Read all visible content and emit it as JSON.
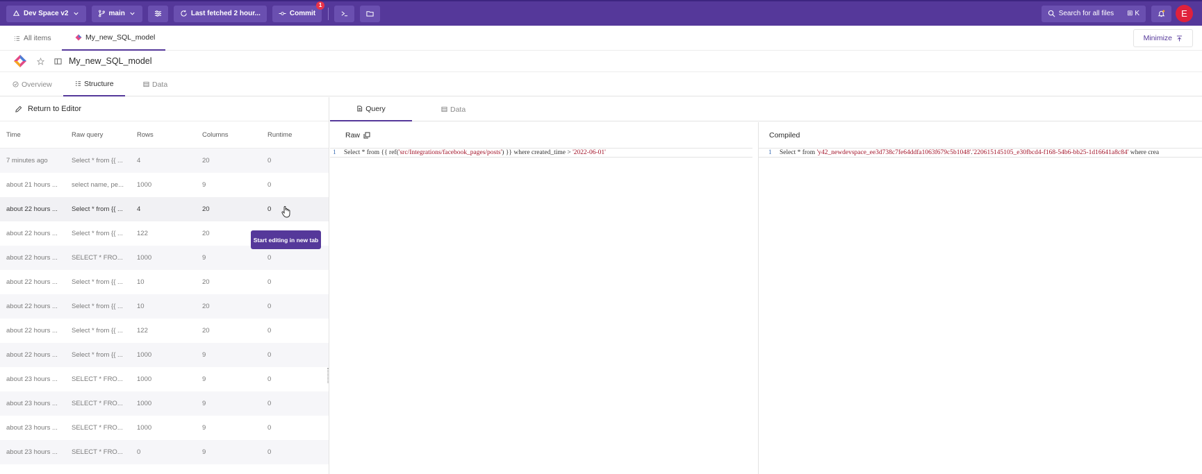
{
  "topbar": {
    "space": "Dev Space v2",
    "branch": "main",
    "fetched": "Last fetched 2 hour...",
    "commit": "Commit",
    "commit_badge": "1",
    "search": "Search for all files",
    "shortcut": "⊞ K",
    "avatar": "E"
  },
  "tabs": {
    "all_items": "All items",
    "model_tab": "My_new_SQL_model",
    "minimize": "Minimize"
  },
  "title": "My_new_SQL_model",
  "subtabs": {
    "overview": "Overview",
    "structure": "Structure",
    "data": "Data"
  },
  "left": {
    "return": "Return to Editor",
    "columns": [
      "Time",
      "Raw query",
      "Rows",
      "Columns",
      "Runtime"
    ],
    "rows": [
      {
        "time": "7 minutes ago",
        "query": "Select * from {{ ...",
        "rows": "4",
        "columns": "20",
        "runtime": "0"
      },
      {
        "time": "about 21 hours ...",
        "query": "select name, pe...",
        "rows": "1000",
        "columns": "9",
        "runtime": "0"
      },
      {
        "time": "about 22 hours ...",
        "query": "Select * from {{ ...",
        "rows": "4",
        "columns": "20",
        "runtime": "0"
      },
      {
        "time": "about 22 hours ...",
        "query": "Select * from {{ ...",
        "rows": "122",
        "columns": "20",
        "runtime": ""
      },
      {
        "time": "about 22 hours ...",
        "query": "SELECT * FRO...",
        "rows": "1000",
        "columns": "9",
        "runtime": "0"
      },
      {
        "time": "about 22 hours ...",
        "query": "Select * from {{ ...",
        "rows": "10",
        "columns": "20",
        "runtime": "0"
      },
      {
        "time": "about 22 hours ...",
        "query": "Select * from {{ ...",
        "rows": "10",
        "columns": "20",
        "runtime": "0"
      },
      {
        "time": "about 22 hours ...",
        "query": "Select * from {{ ...",
        "rows": "122",
        "columns": "20",
        "runtime": "0"
      },
      {
        "time": "about 22 hours ...",
        "query": "Select * from {{ ...",
        "rows": "1000",
        "columns": "9",
        "runtime": "0"
      },
      {
        "time": "about 23 hours ...",
        "query": "SELECT * FRO...",
        "rows": "1000",
        "columns": "9",
        "runtime": "0"
      },
      {
        "time": "about 23 hours ...",
        "query": "SELECT * FRO...",
        "rows": "1000",
        "columns": "9",
        "runtime": "0"
      },
      {
        "time": "about 23 hours ...",
        "query": "SELECT * FRO...",
        "rows": "1000",
        "columns": "9",
        "runtime": "0"
      },
      {
        "time": "about 23 hours ...",
        "query": "SELECT * FRO...",
        "rows": "0",
        "columns": "9",
        "runtime": "0"
      }
    ],
    "tooltip": "Start editing in new tab"
  },
  "right": {
    "tab_query": "Query",
    "tab_data": "Data",
    "raw_label": "Raw",
    "compiled_label": "Compiled",
    "raw_line_no": "1",
    "raw_p1": "Select * from {{ ref(",
    "raw_s1": "'src/Integrations/facebook_pages/posts'",
    "raw_p2": ") }} where created_time > ",
    "raw_s2": "'2022-06-01'",
    "compiled_line_no": "1",
    "comp_p1": "Select * from ",
    "comp_s1": "'y42_newdevspace_ee3d738c7fe64ddfa1063f679c5b1048'",
    "comp_p2": ".",
    "comp_s2": "'220615145105_e30fbcd4-f168-54b6-bb25-1d16641a8c84'",
    "comp_p3": " where crea"
  },
  "colors": {
    "brand": "#55389a",
    "badge": "#e8334a",
    "avatar": "#e0213c",
    "string": "#a3152a"
  }
}
